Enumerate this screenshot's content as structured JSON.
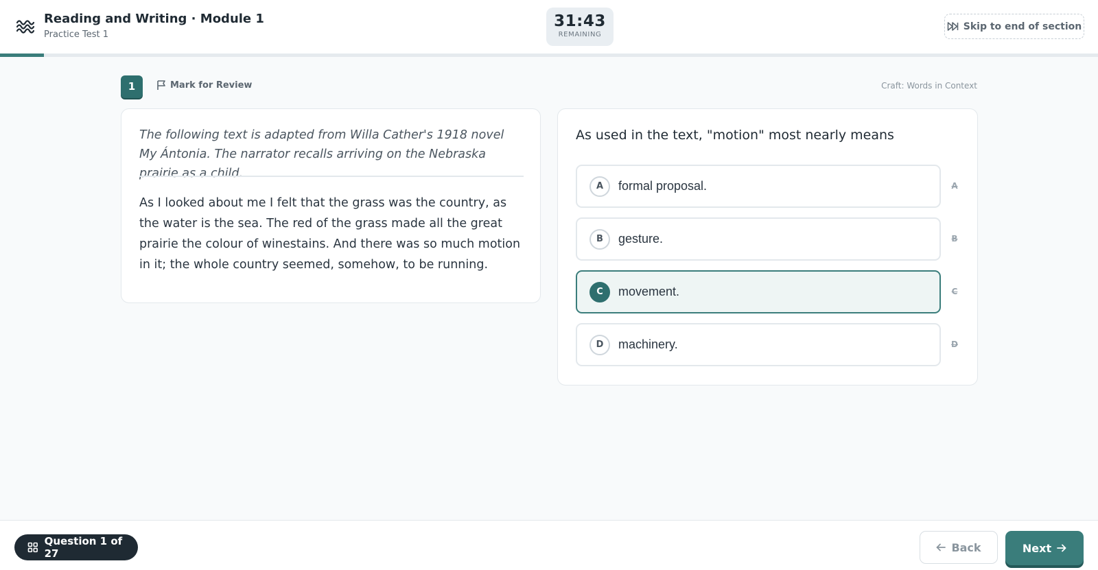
{
  "header": {
    "title": "Reading and Writing · Module 1",
    "subtitle": "Practice Test 1",
    "timer": {
      "value": "31:43",
      "label": "REMAINING"
    },
    "skip_label": "Skip to end of section",
    "progress_fraction": 0.04
  },
  "question_meta": {
    "number": "1",
    "mark_review_label": "Mark for Review",
    "skill": "Craft: Words in Context"
  },
  "passage": {
    "intro": "The following text is adapted from Willa Cather's 1918 novel My Ántonia. The narrator recalls arriving on the Nebraska prairie as a child.",
    "text": "As I looked about me I felt that the grass was the country, as the water is the sea. The red of the grass made all the great prairie the colour of winestains. And there was so much motion in it; the whole country seemed, somehow, to be running."
  },
  "question": {
    "prompt": "As used in the text, \"motion\" most nearly means",
    "options": [
      {
        "letter": "A",
        "text": "formal proposal."
      },
      {
        "letter": "B",
        "text": "gesture."
      },
      {
        "letter": "C",
        "text": "movement."
      },
      {
        "letter": "D",
        "text": "machinery."
      }
    ],
    "selected": "C"
  },
  "footer": {
    "question_nav_label": "Question 1 of 27",
    "back_label": "Back",
    "next_label": "Next"
  },
  "colors": {
    "accent": "#3a7d7b",
    "accent_dark": "#2e6f6e"
  },
  "icons": [
    "logo-icon",
    "skip-forward-icon",
    "flag-icon",
    "grid-icon",
    "arrow-left-icon",
    "arrow-right-icon"
  ]
}
